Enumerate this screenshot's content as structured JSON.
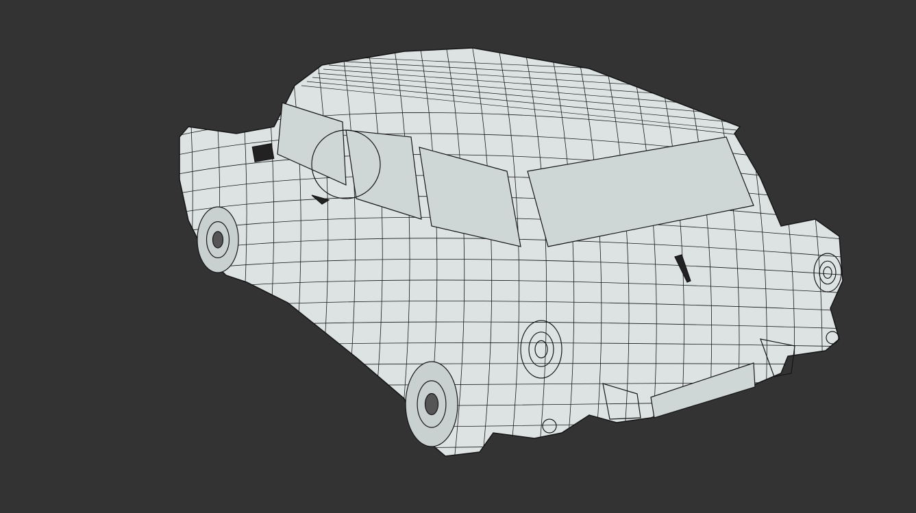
{
  "viewport": {
    "background": "#333333",
    "model_color": "#dde3e3",
    "wire_color": "#151515",
    "glass_color": "#cfd6d6"
  }
}
